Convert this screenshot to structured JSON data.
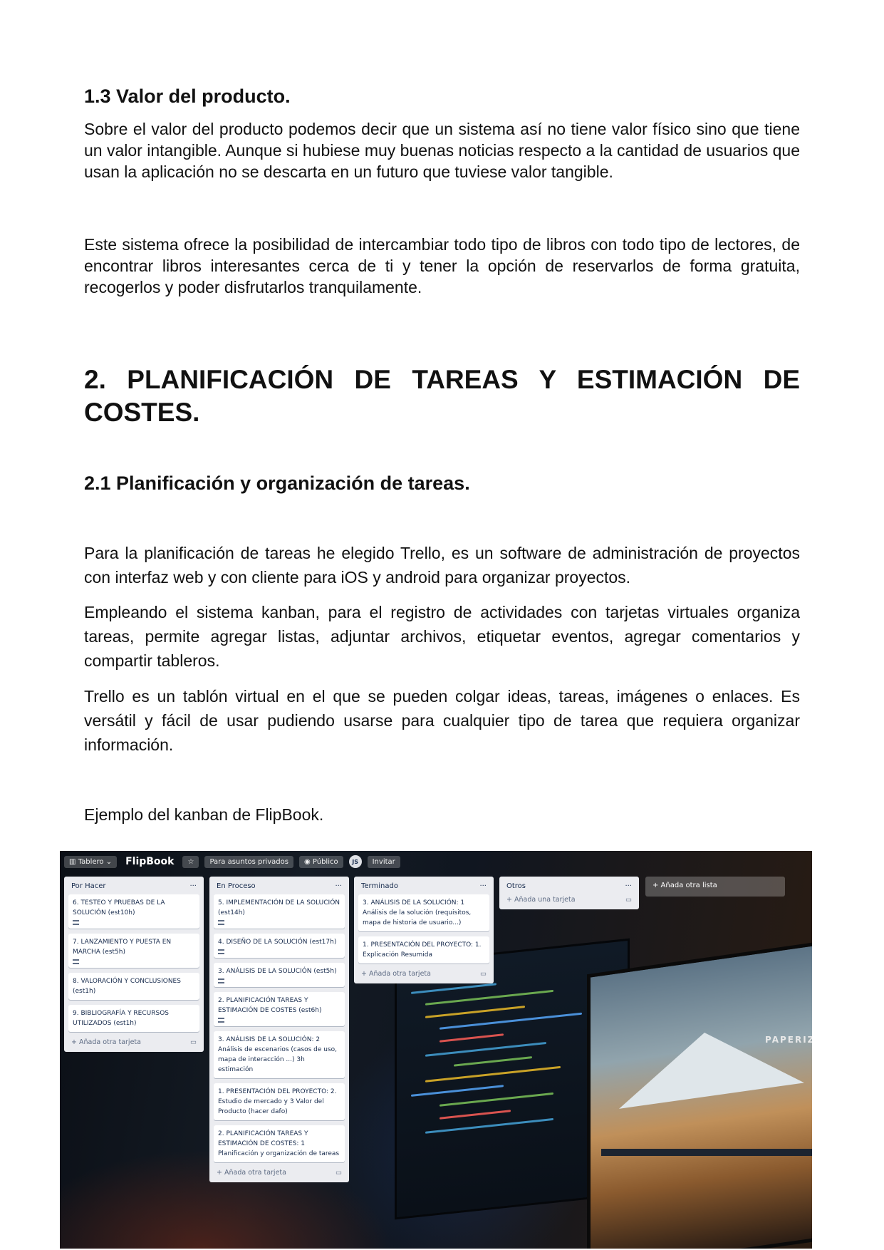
{
  "section_1_3": {
    "heading": "1.3  Valor del producto.",
    "p1": "Sobre el valor del producto podemos decir que un sistema así no tiene valor físico sino que tiene un valor intangible. Aunque si hubiese muy buenas noticias respecto a la cantidad de usuarios que usan la aplicación no se descarta en un futuro que tuviese valor tangible.",
    "p2": "Este sistema ofrece la posibilidad de intercambiar todo tipo de libros con todo tipo de lectores,  de encontrar libros interesantes cerca de ti y tener la opción de reservarlos de forma gratuita, recogerlos y poder disfrutarlos tranquilamente."
  },
  "section_2": {
    "heading": "2. PLANIFICACIÓN DE TAREAS Y ESTIMACIÓN DE COSTES.",
    "sub_heading": "2.1 Planificación y organización de tareas.",
    "p1": "Para la planificación de tareas he elegido Trello, es un software de administración de proyectos con interfaz web y con cliente para iOS y android para organizar proyectos.",
    "p2": "Empleando el sistema kanban, para el registro de actividades con tarjetas virtuales organiza tareas, permite agregar listas, adjuntar archivos, etiquetar eventos, agregar comentarios y compartir tableros.",
    "p3": "Trello es un tablón virtual en el que se pueden colgar ideas, tareas, imágenes o enlaces. Es versátil y fácil de usar pudiendo usarse para cualquier tipo de tarea que requiera organizar información.",
    "caption": "Ejemplo del kanban de FlipBook."
  },
  "trello": {
    "board_menu": "Tablero",
    "board_name": "FlipBook",
    "visibility_team": "Para asuntos privados",
    "visibility": "Público",
    "avatar": "JS",
    "invite": "Invitar",
    "add_list": "+ Añada otra lista",
    "list_menu": "···",
    "lists": [
      {
        "title": "Por Hacer",
        "cards": [
          "6. TESTEO Y PRUEBAS DE LA SOLUCIÓN (est10h)",
          "7. LANZAMIENTO Y PUESTA EN MARCHA (est5h)",
          "8. VALORACIÓN Y CONCLUSIONES (est1h)",
          "9. BIBLIOGRAFÍA Y RECURSOS UTILIZADOS (est1h)"
        ],
        "add": "+ Añada otra tarjeta"
      },
      {
        "title": "En Proceso",
        "cards": [
          "5. IMPLEMENTACIÓN DE LA SOLUCIÓN (est14h)",
          "4. DISEÑO DE LA SOLUCIÓN (est17h)",
          "3. ANÁLISIS DE LA SOLUCIÓN (est5h)",
          "2. PLANIFICACIÓN TAREAS Y ESTIMACIÓN DE COSTES (est6h)",
          "3. ANÁLISIS DE LA SOLUCIÓN: 2 Análisis de escenarios (casos de uso, mapa de interacción ...) 3h estimación",
          "1. PRESENTACIÓN DEL PROYECTO: 2. Estudio de mercado y 3 Valor del Producto (hacer dafo)",
          "2. PLANIFICACIÓN TAREAS Y ESTIMACIÓN DE COSTES: 1 Planificación y organización de tareas"
        ],
        "add": "+ Añada otra tarjeta"
      },
      {
        "title": "Terminado",
        "cards": [
          "3. ANÁLISIS DE LA SOLUCIÓN: 1 Análisis de la solución (requisitos, mapa de historia de usuario...)",
          "1. PRESENTACIÓN DEL PROYECTO: 1. Explicación Resumida"
        ],
        "add": "+ Añada otra tarjeta"
      },
      {
        "title": "Otros",
        "cards": [],
        "add": "+ Añada una tarjeta"
      }
    ],
    "monitor_text": "PAPERIZ"
  }
}
